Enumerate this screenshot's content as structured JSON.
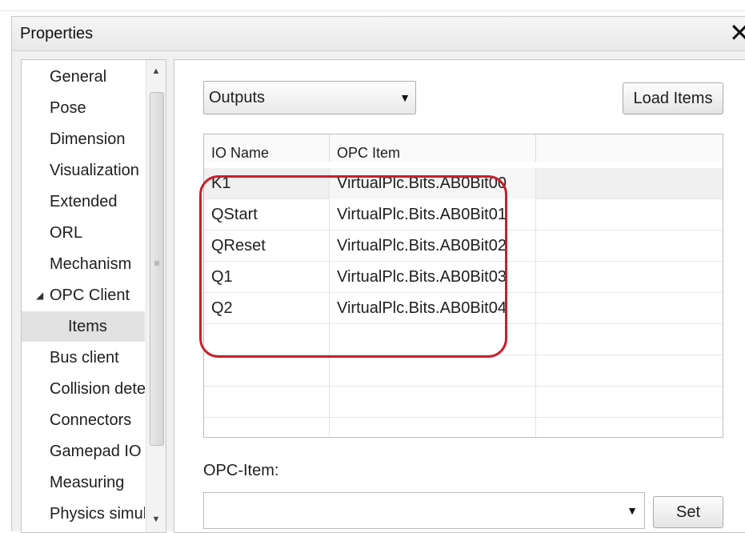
{
  "window": {
    "title": "Properties",
    "close_icon": "close-icon"
  },
  "tree": {
    "items": [
      {
        "label": "General"
      },
      {
        "label": "Pose"
      },
      {
        "label": "Dimension"
      },
      {
        "label": "Visualization"
      },
      {
        "label": "Extended"
      },
      {
        "label": "ORL"
      },
      {
        "label": "Mechanism"
      },
      {
        "label": "OPC Client",
        "expanded": true
      },
      {
        "label": "Items",
        "selected": true
      },
      {
        "label": "Bus client"
      },
      {
        "label": "Collision dete"
      },
      {
        "label": "Connectors"
      },
      {
        "label": "Gamepad IO"
      },
      {
        "label": "Measuring"
      },
      {
        "label": "Physics simula"
      }
    ],
    "expand_glyph": "◢"
  },
  "io_panel": {
    "selector_value": "Outputs",
    "load_button": "Load Items",
    "columns": [
      "IO Name",
      "OPC Item"
    ],
    "rows": [
      {
        "io_name": "K1",
        "opc_item": "VirtualPlc.Bits.AB0Bit00"
      },
      {
        "io_name": "QStart",
        "opc_item": "VirtualPlc.Bits.AB0Bit01"
      },
      {
        "io_name": "QReset",
        "opc_item": "VirtualPlc.Bits.AB0Bit02"
      },
      {
        "io_name": "Q1",
        "opc_item": "VirtualPlc.Bits.AB0Bit03"
      },
      {
        "io_name": "Q2",
        "opc_item": "VirtualPlc.Bits.AB0Bit04"
      }
    ],
    "opc_item_label": "OPC-Item:",
    "opc_item_value": "",
    "set_button": "Set"
  },
  "colors": {
    "highlight": "#c8202a",
    "selected_bg": "#e1e1e1"
  }
}
